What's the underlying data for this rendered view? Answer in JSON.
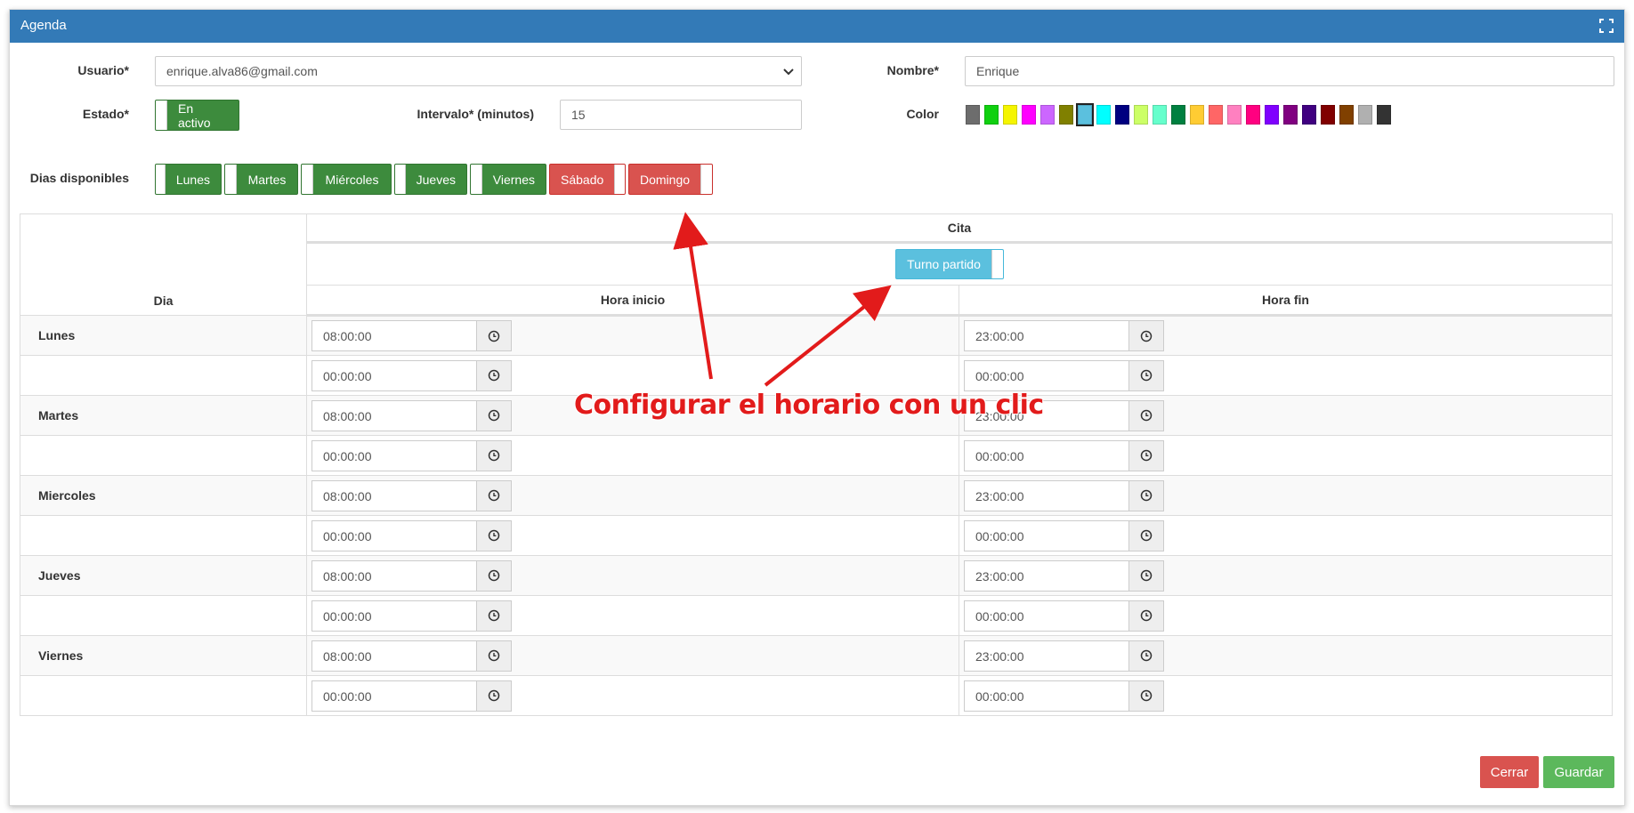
{
  "window": {
    "title": "Agenda"
  },
  "form": {
    "usuario_label": "Usuario*",
    "usuario_value": "enrique.alva86@gmail.com",
    "nombre_label": "Nombre*",
    "nombre_value": "Enrique",
    "estado_label": "Estado*",
    "estado_value": "En activo",
    "intervalo_label": "Intervalo* (minutos)",
    "intervalo_value": "15",
    "color_label": "Color",
    "colors": [
      "#6d6d6d",
      "#10d010",
      "#f5f500",
      "#ff00ff",
      "#cc66ff",
      "#808000",
      "#5bc0de",
      "#00ffff",
      "#000080",
      "#ccff66",
      "#66ffcc",
      "#008040",
      "#ffcc33",
      "#ff6666",
      "#ff80c0",
      "#ff0080",
      "#8000ff",
      "#800080",
      "#400080",
      "#800000",
      "#804000",
      "#b0b0b0",
      "#333333"
    ],
    "selected_color": "#5bc0de",
    "dias_label": "Dias disponibles",
    "dias": [
      {
        "label": "Lunes",
        "on": true
      },
      {
        "label": "Martes",
        "on": true
      },
      {
        "label": "Miércoles",
        "on": true
      },
      {
        "label": "Jueves",
        "on": true
      },
      {
        "label": "Viernes",
        "on": true
      },
      {
        "label": "Sábado",
        "on": false
      },
      {
        "label": "Domingo",
        "on": false
      }
    ]
  },
  "table": {
    "cita_header": "Cita",
    "turno_partido": "Turno partido",
    "dia_header": "Dia",
    "inicio_header": "Hora inicio",
    "fin_header": "Hora fin",
    "rows": [
      {
        "day": "Lunes",
        "start": "08:00:00",
        "end": "23:00:00"
      },
      {
        "day": "",
        "start": "00:00:00",
        "end": "00:00:00"
      },
      {
        "day": "Martes",
        "start": "08:00:00",
        "end": "23:00:00"
      },
      {
        "day": "",
        "start": "00:00:00",
        "end": "00:00:00"
      },
      {
        "day": "Miercoles",
        "start": "08:00:00",
        "end": "23:00:00"
      },
      {
        "day": "",
        "start": "00:00:00",
        "end": "00:00:00"
      },
      {
        "day": "Jueves",
        "start": "08:00:00",
        "end": "23:00:00"
      },
      {
        "day": "",
        "start": "00:00:00",
        "end": "00:00:00"
      },
      {
        "day": "Viernes",
        "start": "08:00:00",
        "end": "23:00:00"
      },
      {
        "day": "",
        "start": "00:00:00",
        "end": "00:00:00"
      }
    ]
  },
  "footer": {
    "cerrar": "Cerrar",
    "guardar": "Guardar"
  },
  "annotation": "Configurar el horario con un clic"
}
